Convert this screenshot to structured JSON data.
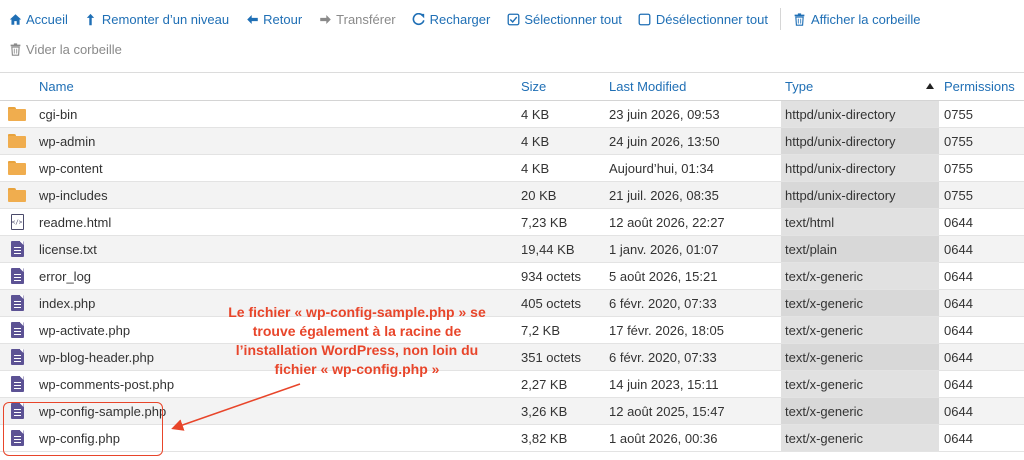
{
  "toolbar": {
    "row1": [
      {
        "label": "Accueil",
        "icon": "home-icon",
        "enabled": true
      },
      {
        "label": "Remonter d’un niveau",
        "icon": "level-up-icon",
        "enabled": true
      },
      {
        "label": "Retour",
        "icon": "arrow-left-icon",
        "enabled": true
      },
      {
        "label": "Transférer",
        "icon": "arrow-right-icon",
        "enabled": false
      },
      {
        "label": "Recharger",
        "icon": "refresh-icon",
        "enabled": true
      },
      {
        "label": "Sélectionner tout",
        "icon": "checkbox-checked-icon",
        "enabled": true
      },
      {
        "label": "Désélectionner tout",
        "icon": "checkbox-empty-icon",
        "enabled": true
      },
      {
        "label": "Afficher la corbeille",
        "icon": "trash-icon",
        "enabled": true
      }
    ],
    "row2": [
      {
        "label": "Vider la corbeille",
        "icon": "trash-icon",
        "enabled": false
      }
    ]
  },
  "columns": {
    "name": "Name",
    "size": "Size",
    "modified": "Last Modified",
    "type": "Type",
    "permissions": "Permissions",
    "sorted_by": "Type",
    "sort_direction": "ascending"
  },
  "files": [
    {
      "name": "cgi-bin",
      "size": "4 KB",
      "modified": "23 juin 2026, 09:53",
      "type": "httpd/unix-directory",
      "perm": "0755",
      "kind": "folder"
    },
    {
      "name": "wp-admin",
      "size": "4 KB",
      "modified": "24 juin 2026, 13:50",
      "type": "httpd/unix-directory",
      "perm": "0755",
      "kind": "folder"
    },
    {
      "name": "wp-content",
      "size": "4 KB",
      "modified": "Aujourd’hui, 01:34",
      "type": "httpd/unix-directory",
      "perm": "0755",
      "kind": "folder"
    },
    {
      "name": "wp-includes",
      "size": "20 KB",
      "modified": "21 juil. 2026, 08:35",
      "type": "httpd/unix-directory",
      "perm": "0755",
      "kind": "folder"
    },
    {
      "name": "readme.html",
      "size": "7,23 KB",
      "modified": "12 août 2026, 22:27",
      "type": "text/html",
      "perm": "0644",
      "kind": "html"
    },
    {
      "name": "license.txt",
      "size": "19,44 KB",
      "modified": "1 janv. 2026, 01:07",
      "type": "text/plain",
      "perm": "0644",
      "kind": "file"
    },
    {
      "name": "error_log",
      "size": "934 octets",
      "modified": "5 août 2026, 15:21",
      "type": "text/x-generic",
      "perm": "0644",
      "kind": "file"
    },
    {
      "name": "index.php",
      "size": "405 octets",
      "modified": "6 févr. 2020, 07:33",
      "type": "text/x-generic",
      "perm": "0644",
      "kind": "file"
    },
    {
      "name": "wp-activate.php",
      "size": "7,2 KB",
      "modified": "17 févr. 2026, 18:05",
      "type": "text/x-generic",
      "perm": "0644",
      "kind": "file"
    },
    {
      "name": "wp-blog-header.php",
      "size": "351 octets",
      "modified": "6 févr. 2020, 07:33",
      "type": "text/x-generic",
      "perm": "0644",
      "kind": "file"
    },
    {
      "name": "wp-comments-post.php",
      "size": "2,27 KB",
      "modified": "14 juin 2023, 15:11",
      "type": "text/x-generic",
      "perm": "0644",
      "kind": "file"
    },
    {
      "name": "wp-config-sample.php",
      "size": "3,26 KB",
      "modified": "12 août 2025, 15:47",
      "type": "text/x-generic",
      "perm": "0644",
      "kind": "file"
    },
    {
      "name": "wp-config.php",
      "size": "3,82 KB",
      "modified": "1 août 2026, 00:36",
      "type": "text/x-generic",
      "perm": "0644",
      "kind": "file"
    }
  ],
  "annotation": {
    "lines": [
      "Le fichier « wp-config-sample.php » se",
      "trouve également à la racine de",
      "l’installation WordPress, non loin du",
      "fichier « wp-config.php »"
    ],
    "color": "#e8452a"
  },
  "colors": {
    "link": "#1f6fb5",
    "disabled": "#8a8a8a",
    "folder": "#f0ad4e",
    "file": "#5c5294"
  }
}
